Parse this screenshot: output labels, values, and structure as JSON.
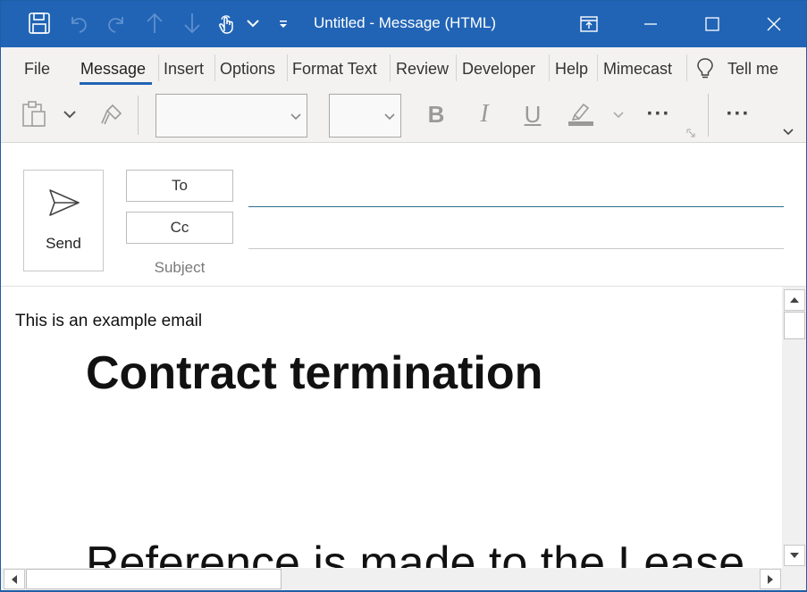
{
  "window": {
    "title": "Untitled  -  Message (HTML)",
    "colors": {
      "titlebar": "#2164b5",
      "ribbon": "#f3f2f1",
      "accent": "#2164b5"
    }
  },
  "quick_access": [
    "save-icon",
    "undo-icon",
    "redo-icon",
    "up-icon",
    "down-icon",
    "touch-mode-icon",
    "chevron-down-icon",
    "customize-icon"
  ],
  "menu": {
    "tabs": [
      "File",
      "Message",
      "Insert",
      "Options",
      "Format Text",
      "Review",
      "Developer",
      "Help",
      "Mimecast"
    ],
    "active": "Message",
    "tell_me": "Tell me"
  },
  "ribbon": {
    "font_name": "",
    "font_size": "",
    "bold": "B",
    "italic": "I",
    "underline": "U",
    "more": "···",
    "more2": "···"
  },
  "compose": {
    "send_label": "Send",
    "to_label": "To",
    "cc_label": "Cc",
    "subject_label": "Subject",
    "to_value": "",
    "cc_value": "",
    "subject_value": ""
  },
  "body": {
    "intro": "This is an example email",
    "heading": "Contract termination",
    "paragraph_start": "Reference is made to the Lease"
  }
}
